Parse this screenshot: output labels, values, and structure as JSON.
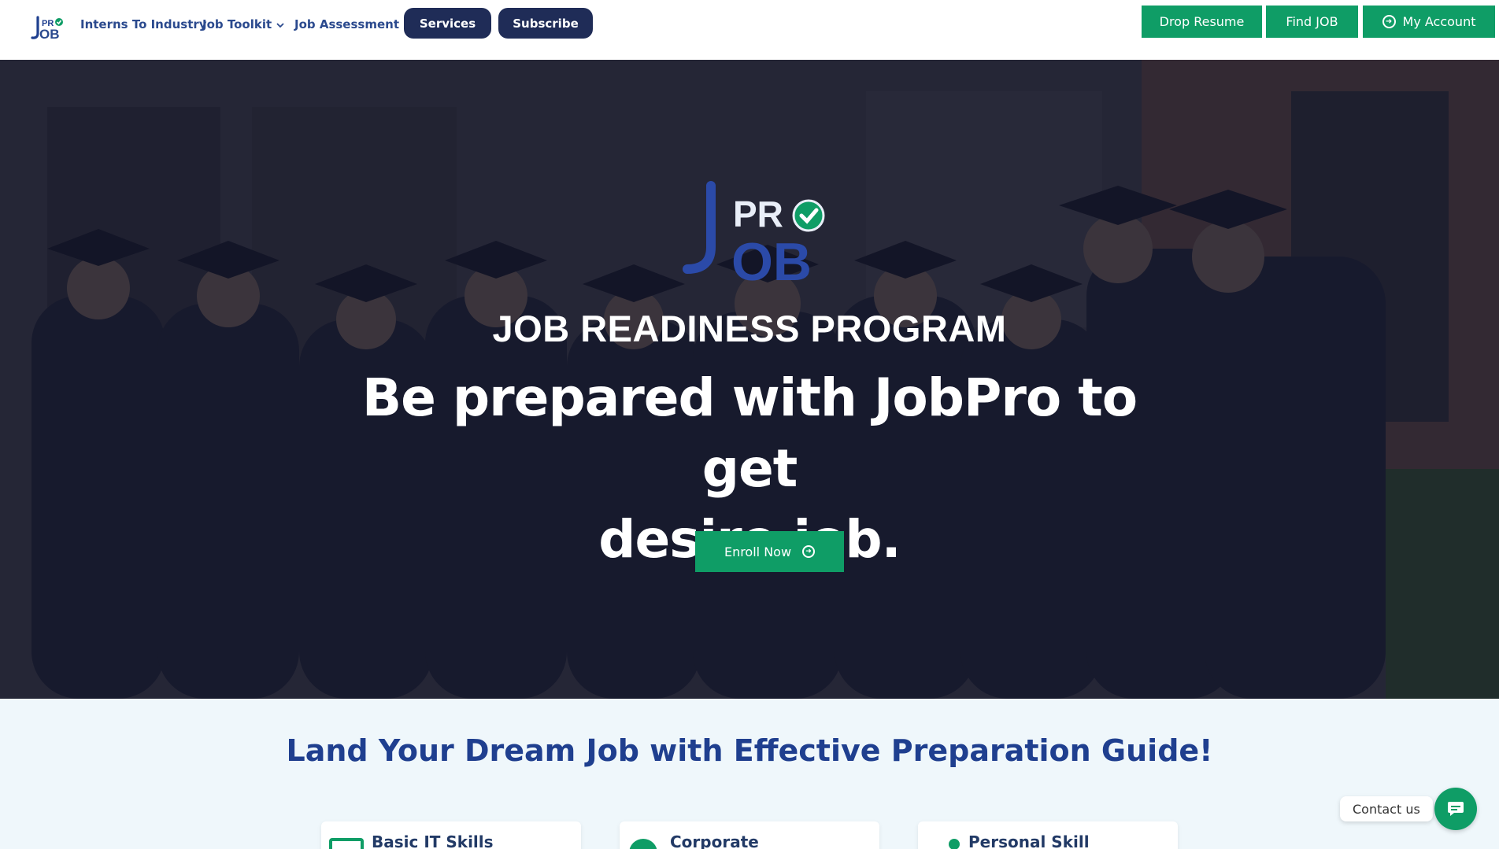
{
  "colors": {
    "brand_navy": "#1f2c57",
    "brand_blue": "#2b4a8e",
    "accent_green": "#0f9d66",
    "section_bg": "#eff7fb",
    "heading_blue": "#1f3f8f"
  },
  "header": {
    "logo_icon": "jobpro-logo-icon",
    "nav": [
      {
        "label": "Interns To Industry"
      },
      {
        "label": "Job Toolkit",
        "icon": "chevron-down-icon"
      },
      {
        "label": "Job Assessment"
      }
    ],
    "pills": [
      {
        "label": "Services"
      },
      {
        "label": "Subscribe"
      }
    ],
    "actions": [
      {
        "label": "Drop Resume"
      },
      {
        "label": "Find JOB"
      },
      {
        "label": "My Account",
        "icon": "arrow-circle-right-icon"
      }
    ]
  },
  "hero": {
    "logo_icon": "jobpro-logo-icon",
    "kicker": "JOB READINESS PROGRAM",
    "title_line1": "Be prepared with JobPro to get",
    "title_line2": "desire job.",
    "cta": {
      "label": "Enroll Now",
      "icon": "arrow-circle-right-icon"
    }
  },
  "section": {
    "title": "Land Your Dream Job with Effective Preparation Guide!",
    "cards": [
      {
        "label": "Basic IT Skills",
        "icon": "monitor-icon"
      },
      {
        "label": "Corporate",
        "icon": "circle-icon"
      },
      {
        "label": "Personal Skill",
        "icon": "dot-icon"
      }
    ]
  },
  "contact": {
    "label": "Contact us",
    "icon": "chat-icon"
  }
}
